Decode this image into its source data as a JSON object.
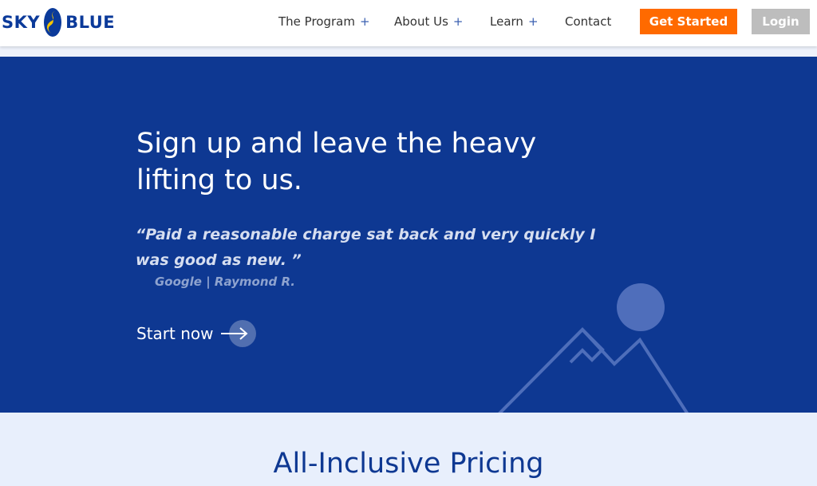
{
  "brand": {
    "name_left": "SKY",
    "name_right": "BLUE",
    "colors": {
      "primary": "#0e3892",
      "accent": "#ff6a00",
      "logo_yellow": "#f5c400"
    }
  },
  "nav": {
    "items": [
      {
        "label": "The Program",
        "has_submenu": true,
        "submenu_icon": "+"
      },
      {
        "label": "About Us",
        "has_submenu": true,
        "submenu_icon": "+"
      },
      {
        "label": "Learn",
        "has_submenu": true,
        "submenu_icon": "+"
      },
      {
        "label": "Contact",
        "has_submenu": false
      }
    ],
    "get_started_label": "Get Started",
    "login_label": "Login"
  },
  "hero": {
    "title": "Sign up and leave the heavy lifting to us.",
    "quote": "“Paid a reasonable charge sat back and very quickly I was good as new. ”",
    "source": "Google | Raymond R.",
    "cta_label": "Start now",
    "cta_icon": "arrow-right-icon",
    "background_color": "#0e3892"
  },
  "pricing": {
    "title": "All-Inclusive Pricing",
    "background_color": "#e8effc"
  }
}
